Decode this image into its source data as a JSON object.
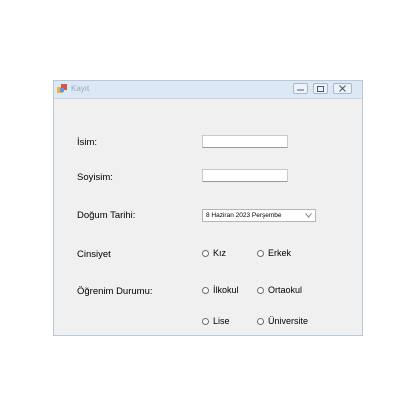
{
  "window": {
    "title": "Kayıt"
  },
  "form": {
    "name_label": "İsim:",
    "surname_label": "Soyisim:",
    "birthdate_label": "Doğum Tarihi:",
    "gender_label": "Cinsiyet",
    "education_label": "Öğrenim Durumu:",
    "name_value": "",
    "surname_value": "",
    "birthdate_value": "8 Haziran 2023 Perşembe",
    "gender_options": [
      "Kız",
      "Erkek"
    ],
    "education_options": [
      "İlkokul",
      "Ortaokul",
      "Lise",
      "Üniversite"
    ]
  },
  "icons": {
    "app": "app-icon",
    "minimize": "minimize-icon",
    "maximize": "maximize-icon",
    "close": "close-icon",
    "dropdown": "chevron-down-icon"
  }
}
